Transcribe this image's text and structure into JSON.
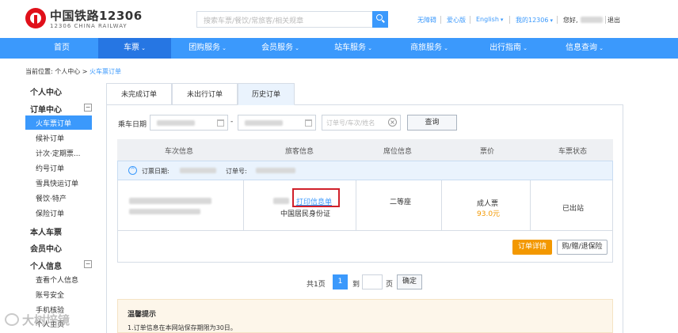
{
  "header": {
    "logo_cn": "中国铁路12306",
    "logo_en": "12306 CHINA RAILWAY",
    "search_placeholder": "搜索车票/餐饮/常旅客/相关规章",
    "links": {
      "accessible": "无障碍",
      "care": "爱心版",
      "english": "English",
      "my12306": "我的12306",
      "greeting": "您好,",
      "logout": "退出"
    }
  },
  "nav": {
    "items": [
      {
        "label": "首页"
      },
      {
        "label": "车票"
      },
      {
        "label": "团购服务"
      },
      {
        "label": "会员服务"
      },
      {
        "label": "站车服务"
      },
      {
        "label": "商旅服务"
      },
      {
        "label": "出行指南"
      },
      {
        "label": "信息查询"
      }
    ]
  },
  "breadcrumb": {
    "prefix": "当前位置:",
    "parent": "个人中心 >",
    "current": "火车票订单"
  },
  "sidebar": {
    "personal_center": "个人中心",
    "order_center": "订单中心",
    "order_items": [
      "火车票订单",
      "候补订单",
      "计次·定期票...",
      "约号订单",
      "雪具快运订单",
      "餐饮·特产",
      "保险订单"
    ],
    "my_tickets": "本人车票",
    "member_center": "会员中心",
    "personal_info": "个人信息",
    "info_items": [
      "查看个人信息",
      "账号安全",
      "手机核验",
      "个人主页"
    ],
    "collapse_symbol": "−"
  },
  "tabs": [
    "未完成订单",
    "未出行订单",
    "历史订单"
  ],
  "filter": {
    "date_label": "乘车日期",
    "dash": "-",
    "order_placeholder": "订单号/车次/姓名",
    "clear_symbol": "×",
    "query_label": "查询"
  },
  "table": {
    "headers": [
      "车次信息",
      "旅客信息",
      "席位信息",
      "票价",
      "车票状态"
    ],
    "order_date_label": "订票日期:",
    "order_no_label": "订单号:",
    "expand_symbol": "^",
    "row": {
      "print_link": "打印信息单",
      "id_type": "中国居民身份证",
      "seat": "二等座",
      "ticket_type": "成人票",
      "price": "93.0元",
      "status": "已出站"
    },
    "detail_button": "订单详情",
    "insurance_button": "购/赠/退保险"
  },
  "pagination": {
    "total_prefix": "共1页",
    "current": "1",
    "goto_label": "到",
    "page_label": "页",
    "confirm": "确定"
  },
  "tips": {
    "title": "温馨提示",
    "line1": "1.订单信息在本网站保存期限为30日。"
  },
  "watermark": "大树培镜"
}
